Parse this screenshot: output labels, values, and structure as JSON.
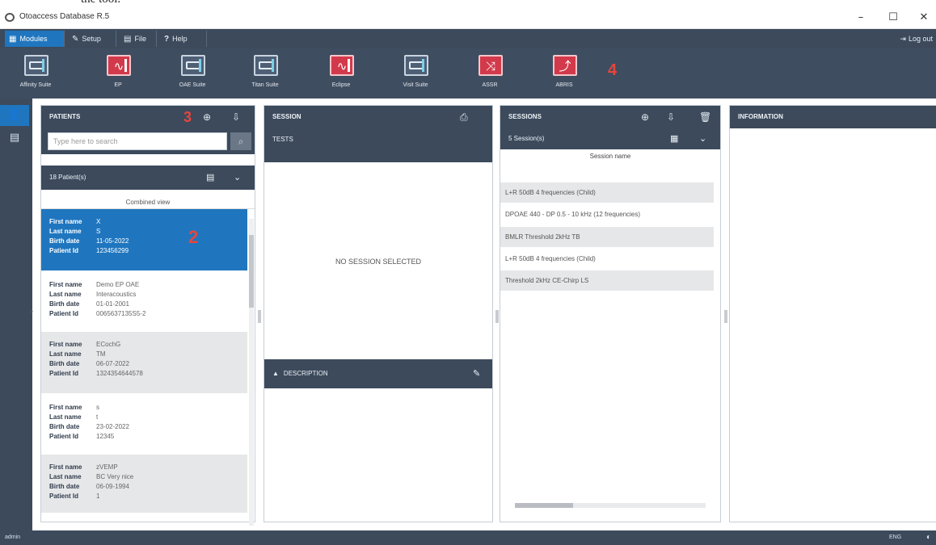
{
  "top_text": "the tool.",
  "window": {
    "title": "Otoaccess Database R.5",
    "minimize": "–",
    "maximize": "☐",
    "close": "✕"
  },
  "menu": {
    "items": [
      {
        "label": "Modules",
        "icon": "grid-icon"
      },
      {
        "label": "Setup",
        "icon": "wrench-icon"
      },
      {
        "label": "File",
        "icon": "file-icon"
      },
      {
        "label": "Help",
        "icon": "question-icon"
      }
    ],
    "logout": "Log out"
  },
  "modules": [
    {
      "label": "Affinity Suite",
      "style": "device"
    },
    {
      "label": "EP",
      "style": "red-wave"
    },
    {
      "label": "OAE Suite",
      "style": "device"
    },
    {
      "label": "Titan Suite",
      "style": "device"
    },
    {
      "label": "Eclipse",
      "style": "red-wave"
    },
    {
      "label": "Visit Suite",
      "style": "device"
    },
    {
      "label": "ASSR",
      "style": "red-graph"
    },
    {
      "label": "ABRIS",
      "style": "red-graph"
    }
  ],
  "markers": {
    "one": "2",
    "two": "3",
    "three": "4"
  },
  "patients": {
    "header": "PATIENTS",
    "search_placeholder": "Type here to search",
    "count": "18 Patient(s)",
    "combined_view": "Combined view",
    "field_labels": [
      "First name",
      "Last name",
      "Birth date",
      "Patient Id"
    ],
    "list": [
      {
        "first": "X",
        "last": "S",
        "birth": "11-05-2022",
        "id": "123456299"
      },
      {
        "first": "Demo EP OAE",
        "last": "Interacoustics",
        "birth": "01-01-2001",
        "id": "0065637135S5-2"
      },
      {
        "first": "ECochG",
        "last": "TM",
        "birth": "06-07-2022",
        "id": "1324354644578"
      },
      {
        "first": "s",
        "last": "t",
        "birth": "23-02-2022",
        "id": "12345"
      },
      {
        "first": "zVEMP",
        "last": "BC Very nice",
        "birth": "06-09-1994",
        "id": "1"
      }
    ]
  },
  "session": {
    "header": "SESSION",
    "tests": "TESTS",
    "empty": "NO SESSION SELECTED",
    "description": "DESCRIPTION"
  },
  "sessions": {
    "header": "SESSIONS",
    "count": "5 Session(s)",
    "column": "Session name",
    "rows": [
      "L+R 50dB 4 frequencies (Child)",
      "DPOAE 440 - DP 0.5 - 10 kHz (12 frequencies)",
      "BMLR Threshold 2kHz TB",
      "L+R 50dB 4 frequencies (Child)",
      "Threshold 2kHz CE-Chirp LS"
    ]
  },
  "information": {
    "header": "INFORMATION"
  },
  "status": {
    "user": "admin",
    "lang": "ENG"
  }
}
